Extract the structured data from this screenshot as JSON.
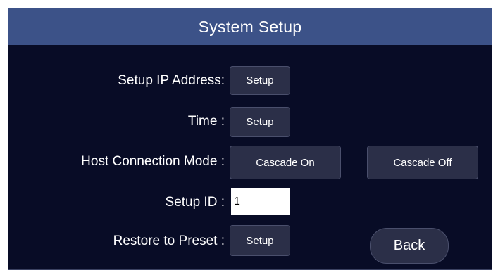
{
  "title": "System Setup",
  "rows": {
    "ip_address": {
      "label": "Setup IP Address:",
      "button": "Setup"
    },
    "time": {
      "label": "Time :",
      "button": "Setup"
    },
    "host_connection": {
      "label": "Host Connection Mode :",
      "button_on": "Cascade On",
      "button_off": "Cascade Off"
    },
    "setup_id": {
      "label": "Setup ID :",
      "value": "1"
    },
    "restore": {
      "label": "Restore to Preset :",
      "button": "Setup"
    }
  },
  "back_label": "Back",
  "colors": {
    "background": "#080c26",
    "title_bar": "#3c5288",
    "button": "#2b2f48"
  }
}
